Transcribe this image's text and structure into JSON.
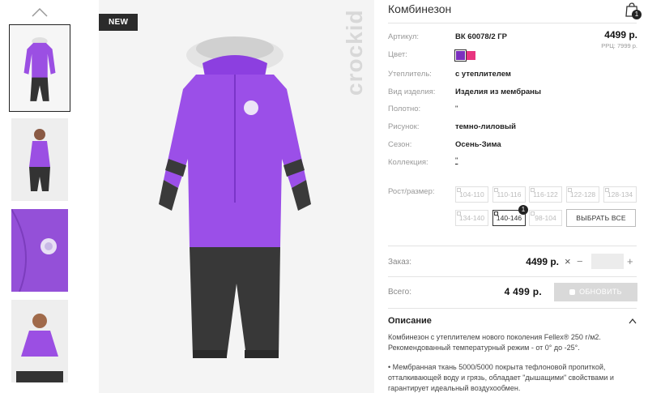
{
  "product": {
    "title": "Комбинезон",
    "badge": "NEW",
    "brand_watermark": "crockid",
    "price": "4499 р.",
    "rrp": "РРЦ: 7999 р."
  },
  "cart": {
    "count": "1"
  },
  "attributes": [
    {
      "label": "Артикул:",
      "value": "ВК 60078/2 ГР"
    },
    {
      "label": "Цвет:",
      "value": ""
    },
    {
      "label": "Утеплитель:",
      "value": "с утеплителем"
    },
    {
      "label": "Вид изделия:",
      "value": "Изделия из мембраны"
    },
    {
      "label": "Полотно:",
      "value": "\""
    },
    {
      "label": "Рисунок:",
      "value": "темно-лиловый"
    },
    {
      "label": "Сезон:",
      "value": "Осень-Зима"
    },
    {
      "label": "Коллекция:",
      "value": "\""
    }
  ],
  "colors": [
    "#7b2fbe",
    "#e8347f"
  ],
  "sizes": {
    "label": "Рост/размер:",
    "options": [
      "104-110",
      "110-116",
      "116-122",
      "122-128",
      "128-134",
      "134-140",
      "140-146",
      "98-104"
    ],
    "selected": "140-146",
    "selected_count": "1",
    "select_all": "ВЫБРАТЬ ВСЕ"
  },
  "order": {
    "label": "Заказ:",
    "price": "4499 р.",
    "remove": "×",
    "minus": "−",
    "plus": "+"
  },
  "total": {
    "label": "Всего:",
    "price": "4 499 р.",
    "update_button": "ОБНОВИТЬ"
  },
  "description": {
    "title": "Описание",
    "paragraph1": "Комбинезон с утеплителем нового поколения Fellex® 250 г/м2. Рекомендованный температурный режим - от 0° до -25°.",
    "paragraph2": "• Мембранная ткань 5000/5000 покрыта тефлоновой пропиткой, отталкивающей воду и грязь, обладает \"дышащими\" свойствами и гарантирует идеальный воздухообмен."
  },
  "icons": {
    "thumb_up": "chevron-up-icon",
    "cart": "shopping-bag-icon",
    "description_toggle": "chevron-up-icon"
  }
}
